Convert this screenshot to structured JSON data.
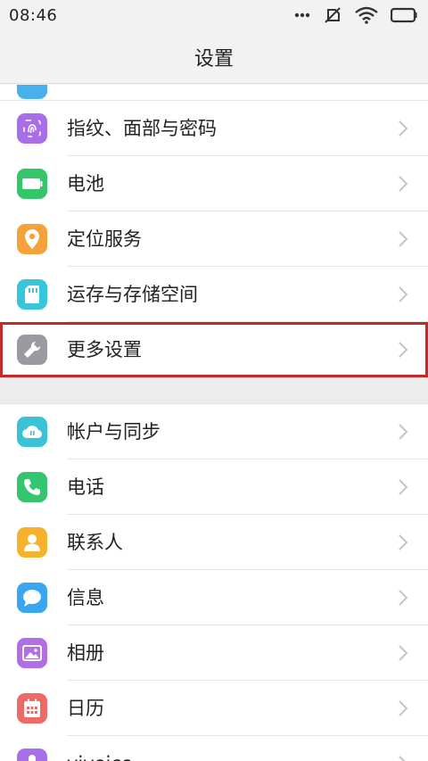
{
  "status_bar": {
    "time": "08:46",
    "icons": [
      "more-dots-icon",
      "muted-vibrate-icon",
      "wifi-icon",
      "battery-icon"
    ]
  },
  "header": {
    "title": "设置"
  },
  "groups": [
    {
      "items": [
        {
          "label": "指纹、面部与密码",
          "icon": "fingerprint-icon",
          "color": "#a86ee8"
        },
        {
          "label": "电池",
          "icon": "battery-icon",
          "color": "#36c66a"
        },
        {
          "label": "定位服务",
          "icon": "location-pin-icon",
          "color": "#f6a23a"
        },
        {
          "label": "运存与存储空间",
          "icon": "sd-card-icon",
          "color": "#36c6dc"
        },
        {
          "label": "更多设置",
          "icon": "wrench-icon",
          "color": "#9a9aa2",
          "highlighted": true
        }
      ]
    },
    {
      "items": [
        {
          "label": "帐户与同步",
          "icon": "cloud-sync-icon",
          "color": "#3ac3d6"
        },
        {
          "label": "电话",
          "icon": "phone-icon",
          "color": "#34c66e"
        },
        {
          "label": "联系人",
          "icon": "contact-person-icon",
          "color": "#f6b22c"
        },
        {
          "label": "信息",
          "icon": "message-bubble-icon",
          "color": "#3aa6f0"
        },
        {
          "label": "相册",
          "icon": "photo-album-icon",
          "color": "#b26ee4"
        },
        {
          "label": "日历",
          "icon": "calendar-icon",
          "color": "#ee6a66"
        },
        {
          "label": "vivoice",
          "icon": "microphone-icon",
          "color": "#a670e8"
        }
      ]
    }
  ],
  "colors": {
    "highlight_border": "#c22a2a",
    "background": "#f4f4f4"
  }
}
